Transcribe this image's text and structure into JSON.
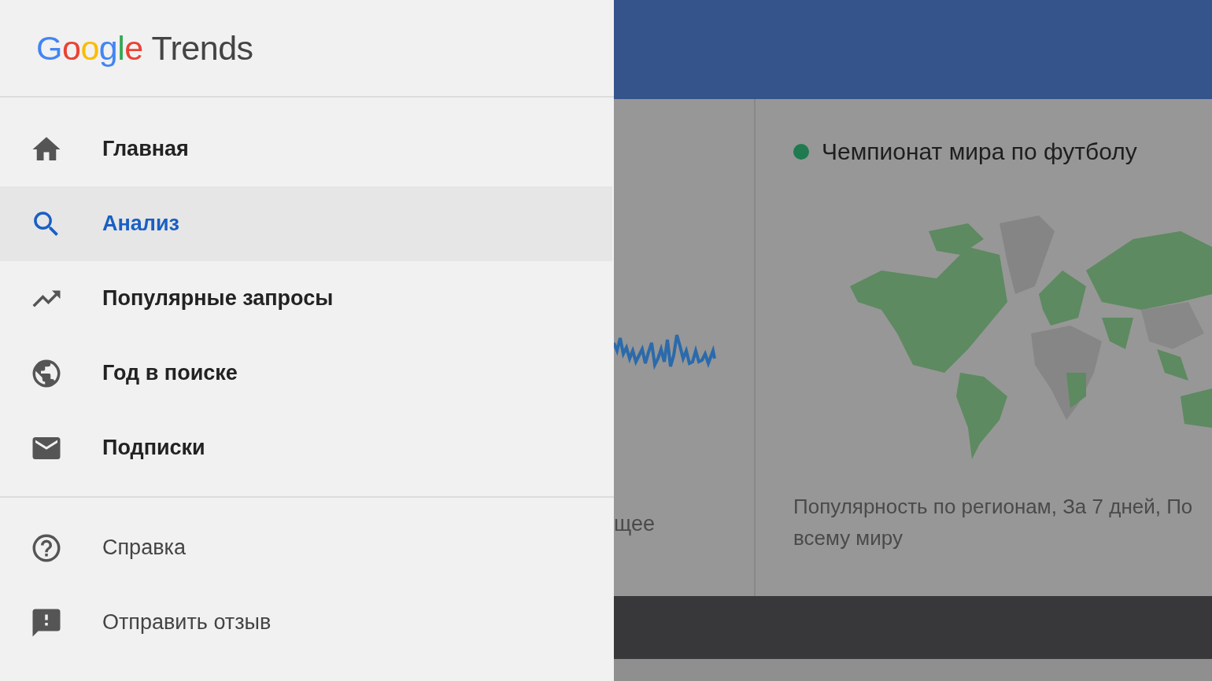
{
  "drawer": {
    "logo": {
      "brand": "Google",
      "product": "Trends"
    },
    "items": [
      {
        "kind": "home",
        "label": "Главная",
        "selected": false
      },
      {
        "kind": "search",
        "label": "Анализ",
        "selected": true
      },
      {
        "kind": "trending",
        "label": "Популярные запросы",
        "selected": false
      },
      {
        "kind": "globe",
        "label": "Год в поиске",
        "selected": false
      },
      {
        "kind": "mail",
        "label": "Подписки",
        "selected": false
      }
    ],
    "secondary_items": [
      {
        "kind": "help",
        "label": "Справка"
      },
      {
        "kind": "feedback",
        "label": "Отправить отзыв"
      }
    ]
  },
  "background": {
    "left_card": {
      "caption": "щее"
    },
    "map_card": {
      "legend": {
        "label": "Чемпионат мира по футболу",
        "color": "#1f7a50"
      },
      "caption": "Популярность по регионам, За 7 дней, По всему миру"
    }
  }
}
